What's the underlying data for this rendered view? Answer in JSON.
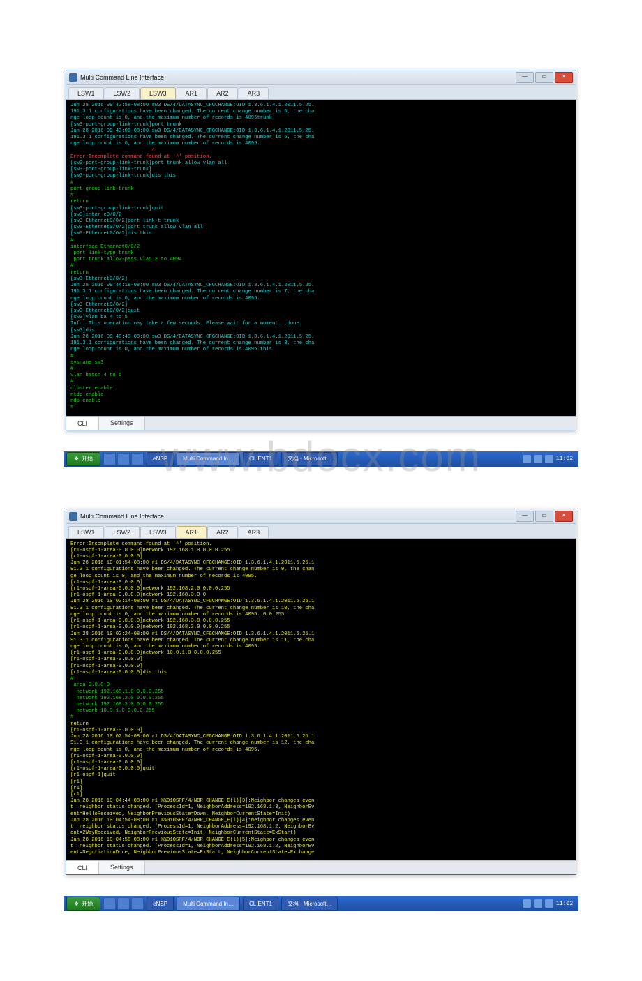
{
  "watermark_text": "www.bdocx.com",
  "time_display": "11:02",
  "windows": [
    {
      "title": "Multi Command Line Interface",
      "tabs": [
        {
          "label": "LSW1"
        },
        {
          "label": "LSW2"
        },
        {
          "label": "LSW3",
          "active": true
        },
        {
          "label": "AR1"
        },
        {
          "label": "AR2"
        },
        {
          "label": "AR3"
        }
      ],
      "bottom_tabs": [
        {
          "label": "CLI",
          "active": true
        },
        {
          "label": "Settings"
        }
      ],
      "lines": [
        {
          "t": "Jun 28 2016 09:42:58-08:00 sw3 DS/4/DATASYNC_CFGCHANGE:OID 1.3.6.1.4.1.2011.5.25.",
          "c": "c"
        },
        {
          "t": "191.3.1 configurations have been changed. The current change number is 5, the cha",
          "c": "c"
        },
        {
          "t": "nge loop count is 0, and the maximum number of records is 4095trunk",
          "c": "c"
        },
        {
          "t": "[sw3-port-group-link-trunk]port trunk",
          "c": "c"
        },
        {
          "t": "Jun 28 2016 09:43:08-08:00 sw3 DS/4/DATASYNC_CFGCHANGE:OID 1.3.6.1.4.1.2011.5.25.",
          "c": "c"
        },
        {
          "t": "191.3.1 configurations have been changed. The current change number is 6, the cha",
          "c": "c"
        },
        {
          "t": "nge loop count is 0, and the maximum number of records is 4095.",
          "c": "c"
        },
        {
          "t": "                           ^",
          "c": "r"
        },
        {
          "t": "Error:Incomplete command found at '^' position.",
          "c": "r"
        },
        {
          "t": "[sw3-port-group-link-trunk]port trunk allow vlan all",
          "c": "c"
        },
        {
          "t": "[sw3-port-group-link-trunk]",
          "c": "c"
        },
        {
          "t": "[sw3-port-group-link-trunk]dis this",
          "c": "c"
        },
        {
          "t": "#",
          "c": "g"
        },
        {
          "t": "port-group link-trunk",
          "c": "g"
        },
        {
          "t": "#",
          "c": "g"
        },
        {
          "t": "return",
          "c": "g"
        },
        {
          "t": "[sw3-port-group-link-trunk]quit",
          "c": "c"
        },
        {
          "t": "[sw3]inter e0/0/2",
          "c": "c"
        },
        {
          "t": "[sw3-Ethernet0/0/2]port link-t trunk",
          "c": "c"
        },
        {
          "t": "[sw3-Ethernet0/0/2]port trunk allow vlan all",
          "c": "c"
        },
        {
          "t": "[sw3-Ethernet0/0/2]dis this",
          "c": "c"
        },
        {
          "t": "#",
          "c": "g"
        },
        {
          "t": "interface Ethernet0/0/2",
          "c": "g"
        },
        {
          "t": " port link-type trunk",
          "c": "g"
        },
        {
          "t": " port trunk allow-pass vlan 2 to 4094",
          "c": "g"
        },
        {
          "t": "#",
          "c": "g"
        },
        {
          "t": "return",
          "c": "g"
        },
        {
          "t": "[sw3-Ethernet0/0/2]",
          "c": "c"
        },
        {
          "t": "Jun 28 2016 09:44:18-08:00 sw3 DS/4/DATASYNC_CFGCHANGE:OID 1.3.6.1.4.1.2011.5.25.",
          "c": "c"
        },
        {
          "t": "191.3.1 configurations have been changed. The current change number is 7, the cha",
          "c": "c"
        },
        {
          "t": "nge loop count is 0, and the maximum number of records is 4095.",
          "c": "c"
        },
        {
          "t": "[sw3-Ethernet0/0/2]",
          "c": "c"
        },
        {
          "t": "[sw3-Ethernet0/0/2]quit",
          "c": "c"
        },
        {
          "t": "[sw3]vlan ba 4 to 5",
          "c": "c"
        },
        {
          "t": "Info: This operation may take a few seconds. Please wait for a moment...done.",
          "c": "c"
        },
        {
          "t": "[sw3]dis",
          "c": "c"
        },
        {
          "t": "Jun 28 2016 09:48:48-08:00 sw3 DS/4/DATASYNC_CFGCHANGE:OID 1.3.6.1.4.1.2011.5.25.",
          "c": "c"
        },
        {
          "t": "191.3.1 configurations have been changed. The current change number is 8, the cha",
          "c": "c"
        },
        {
          "t": "nge loop count is 0, and the maximum number of records is 4095.this",
          "c": "c"
        },
        {
          "t": "#",
          "c": "g"
        },
        {
          "t": "sysname sw3",
          "c": "g"
        },
        {
          "t": "#",
          "c": "g"
        },
        {
          "t": "vlan batch 4 to 5",
          "c": "g"
        },
        {
          "t": "#",
          "c": "g"
        },
        {
          "t": "cluster enable",
          "c": "g"
        },
        {
          "t": "ntdp enable",
          "c": "g"
        },
        {
          "t": "ndp enable",
          "c": "g"
        },
        {
          "t": "#",
          "c": "g"
        }
      ]
    },
    {
      "title": "Multi Command Line Interface",
      "tabs": [
        {
          "label": "LSW1"
        },
        {
          "label": "LSW2"
        },
        {
          "label": "LSW3"
        },
        {
          "label": "AR1",
          "active": true
        },
        {
          "label": "AR2"
        },
        {
          "label": "AR3"
        }
      ],
      "bottom_tabs": [
        {
          "label": "CLI",
          "active": true
        },
        {
          "label": "Settings"
        }
      ],
      "lines": [
        {
          "t": "Error:Incomplete command found at '^' position.",
          "c": "y"
        },
        {
          "t": "[r1-ospf-1-area-0.0.0.0]network 192.168.1.0 0.0.0.255",
          "c": "y"
        },
        {
          "t": "[r1-ospf-1-area-0.0.0.0]",
          "c": "y"
        },
        {
          "t": "Jun 28 2016 10:01:54-08:00 r1 DS/4/DATASYNC_CFGCHANGE:OID 1.3.6.1.4.1.2011.5.25.1",
          "c": "y"
        },
        {
          "t": "91.3.1 configurations have been changed. The current change number is 9, the chan",
          "c": "y"
        },
        {
          "t": "ge loop count is 0, and the maximum number of records is 4095.",
          "c": "y"
        },
        {
          "t": "[r1-ospf-1-area-0.0.0.0]",
          "c": "y"
        },
        {
          "t": "[r1-ospf-1-area-0.0.0.0]network 192.168.2.0 0.0.0.255",
          "c": "y"
        },
        {
          "t": "[r1-ospf-1-area-0.0.0.0]network 192.168.3.0 0",
          "c": "y"
        },
        {
          "t": "Jun 28 2016 10:02:14-08:00 r1 DS/4/DATASYNC_CFGCHANGE:OID 1.3.6.1.4.1.2011.5.25.1",
          "c": "y"
        },
        {
          "t": "91.3.1 configurations have been changed. The current change number is 10, the cha",
          "c": "y"
        },
        {
          "t": "nge loop count is 0, and the maximum number of records is 4095..0.0.255",
          "c": "y"
        },
        {
          "t": "[r1-ospf-1-area-0.0.0.0]network 192.168.3.0 0.0.0.255",
          "c": "y"
        },
        {
          "t": "[r1-ospf-1-area-0.0.0.0]network 192.168.3.0 0.0.0.255",
          "c": "y"
        },
        {
          "t": "Jun 28 2016 10:02:24-08:00 r1 DS/4/DATASYNC_CFGCHANGE:OID 1.3.6.1.4.1.2011.5.25.1",
          "c": "y"
        },
        {
          "t": "91.3.1 configurations have been changed. The current change number is 11, the cha",
          "c": "y"
        },
        {
          "t": "nge loop count is 0, and the maximum number of records is 4095.",
          "c": "y"
        },
        {
          "t": "[r1-ospf-1-area-0.0.0.0]network 10.0.1.0 0.0.0.255",
          "c": "y"
        },
        {
          "t": "[r1-ospf-1-area-0.0.0.0]",
          "c": "y"
        },
        {
          "t": "[r1-ospf-1-area-0.0.0.0]",
          "c": "y"
        },
        {
          "t": "[r1-ospf-1-area-0.0.0.0]dis this",
          "c": "y"
        },
        {
          "t": "#",
          "c": "g"
        },
        {
          "t": " area 0.0.0.0",
          "c": "g"
        },
        {
          "t": "  network 192.168.1.0 0.0.0.255",
          "c": "g"
        },
        {
          "t": "  network 192.168.2.0 0.0.0.255",
          "c": "g"
        },
        {
          "t": "  network 192.168.3.0 0.0.0.255",
          "c": "g"
        },
        {
          "t": "  network 10.0.1.0 0.0.0.255",
          "c": "g"
        },
        {
          "t": "#",
          "c": "g"
        },
        {
          "t": "return",
          "c": "y"
        },
        {
          "t": "[r1-ospf-1-area-0.0.0.0]",
          "c": "y"
        },
        {
          "t": "Jun 28 2016 10:02:54-08:00 r1 DS/4/DATASYNC_CFGCHANGE:OID 1.3.6.1.4.1.2011.5.25.1",
          "c": "y"
        },
        {
          "t": "91.3.1 configurations have been changed. The current change number is 12, the cha",
          "c": "y"
        },
        {
          "t": "nge loop count is 0, and the maximum number of records is 4095.",
          "c": "y"
        },
        {
          "t": "[r1-ospf-1-area-0.0.0.0]",
          "c": "y"
        },
        {
          "t": "[r1-ospf-1-area-0.0.0.0]",
          "c": "y"
        },
        {
          "t": "[r1-ospf-1-area-0.0.0.0]quit",
          "c": "y"
        },
        {
          "t": "[r1-ospf-1]quit",
          "c": "y"
        },
        {
          "t": "[r1]",
          "c": "y"
        },
        {
          "t": "[r1]",
          "c": "y"
        },
        {
          "t": "[r1]",
          "c": "y"
        },
        {
          "t": "Jun 28 2016 10:04:44-08:00 r1 %%01OSPF/4/NBR_CHANGE_E(l)[3]:Neighbor changes even",
          "c": "y"
        },
        {
          "t": "t: neighbor status changed. (ProcessId=1, NeighborAddress=192.168.1.3, NeighborEv",
          "c": "y"
        },
        {
          "t": "ent=HelloReceived, NeighborPreviousState=Down, NeighborCurrentState=Init)",
          "c": "y"
        },
        {
          "t": "Jun 28 2016 10:04:54-08:00 r1 %%01OSPF/4/NBR_CHANGE_E(l)[4]:Neighbor changes even",
          "c": "y"
        },
        {
          "t": "t: neighbor status changed. (ProcessId=1, NeighborAddress=192.168.1.2, NeighborEv",
          "c": "y"
        },
        {
          "t": "ent=2WayReceived, NeighborPreviousState=Init, NeighborCurrentState=ExStart)",
          "c": "y"
        },
        {
          "t": "Jun 28 2016 10:04:58-08:00 r1 %%01OSPF/4/NBR_CHANGE_E(l)[5]:Neighbor changes even",
          "c": "y"
        },
        {
          "t": "t: neighbor status changed. (ProcessId=1, NeighborAddress=192.168.1.2, NeighborEv",
          "c": "y"
        },
        {
          "t": "ent=NegotiationDone, NeighborPreviousState=ExStart, NeighborCurrentState=Exchange",
          "c": "y"
        }
      ]
    }
  ],
  "taskbar": {
    "start_label": "开始",
    "items": [
      {
        "label": "eNSP"
      },
      {
        "label": "Multi Command In…"
      },
      {
        "label": "CLIENT1"
      },
      {
        "label": "文档 - Microsoft…"
      }
    ]
  }
}
